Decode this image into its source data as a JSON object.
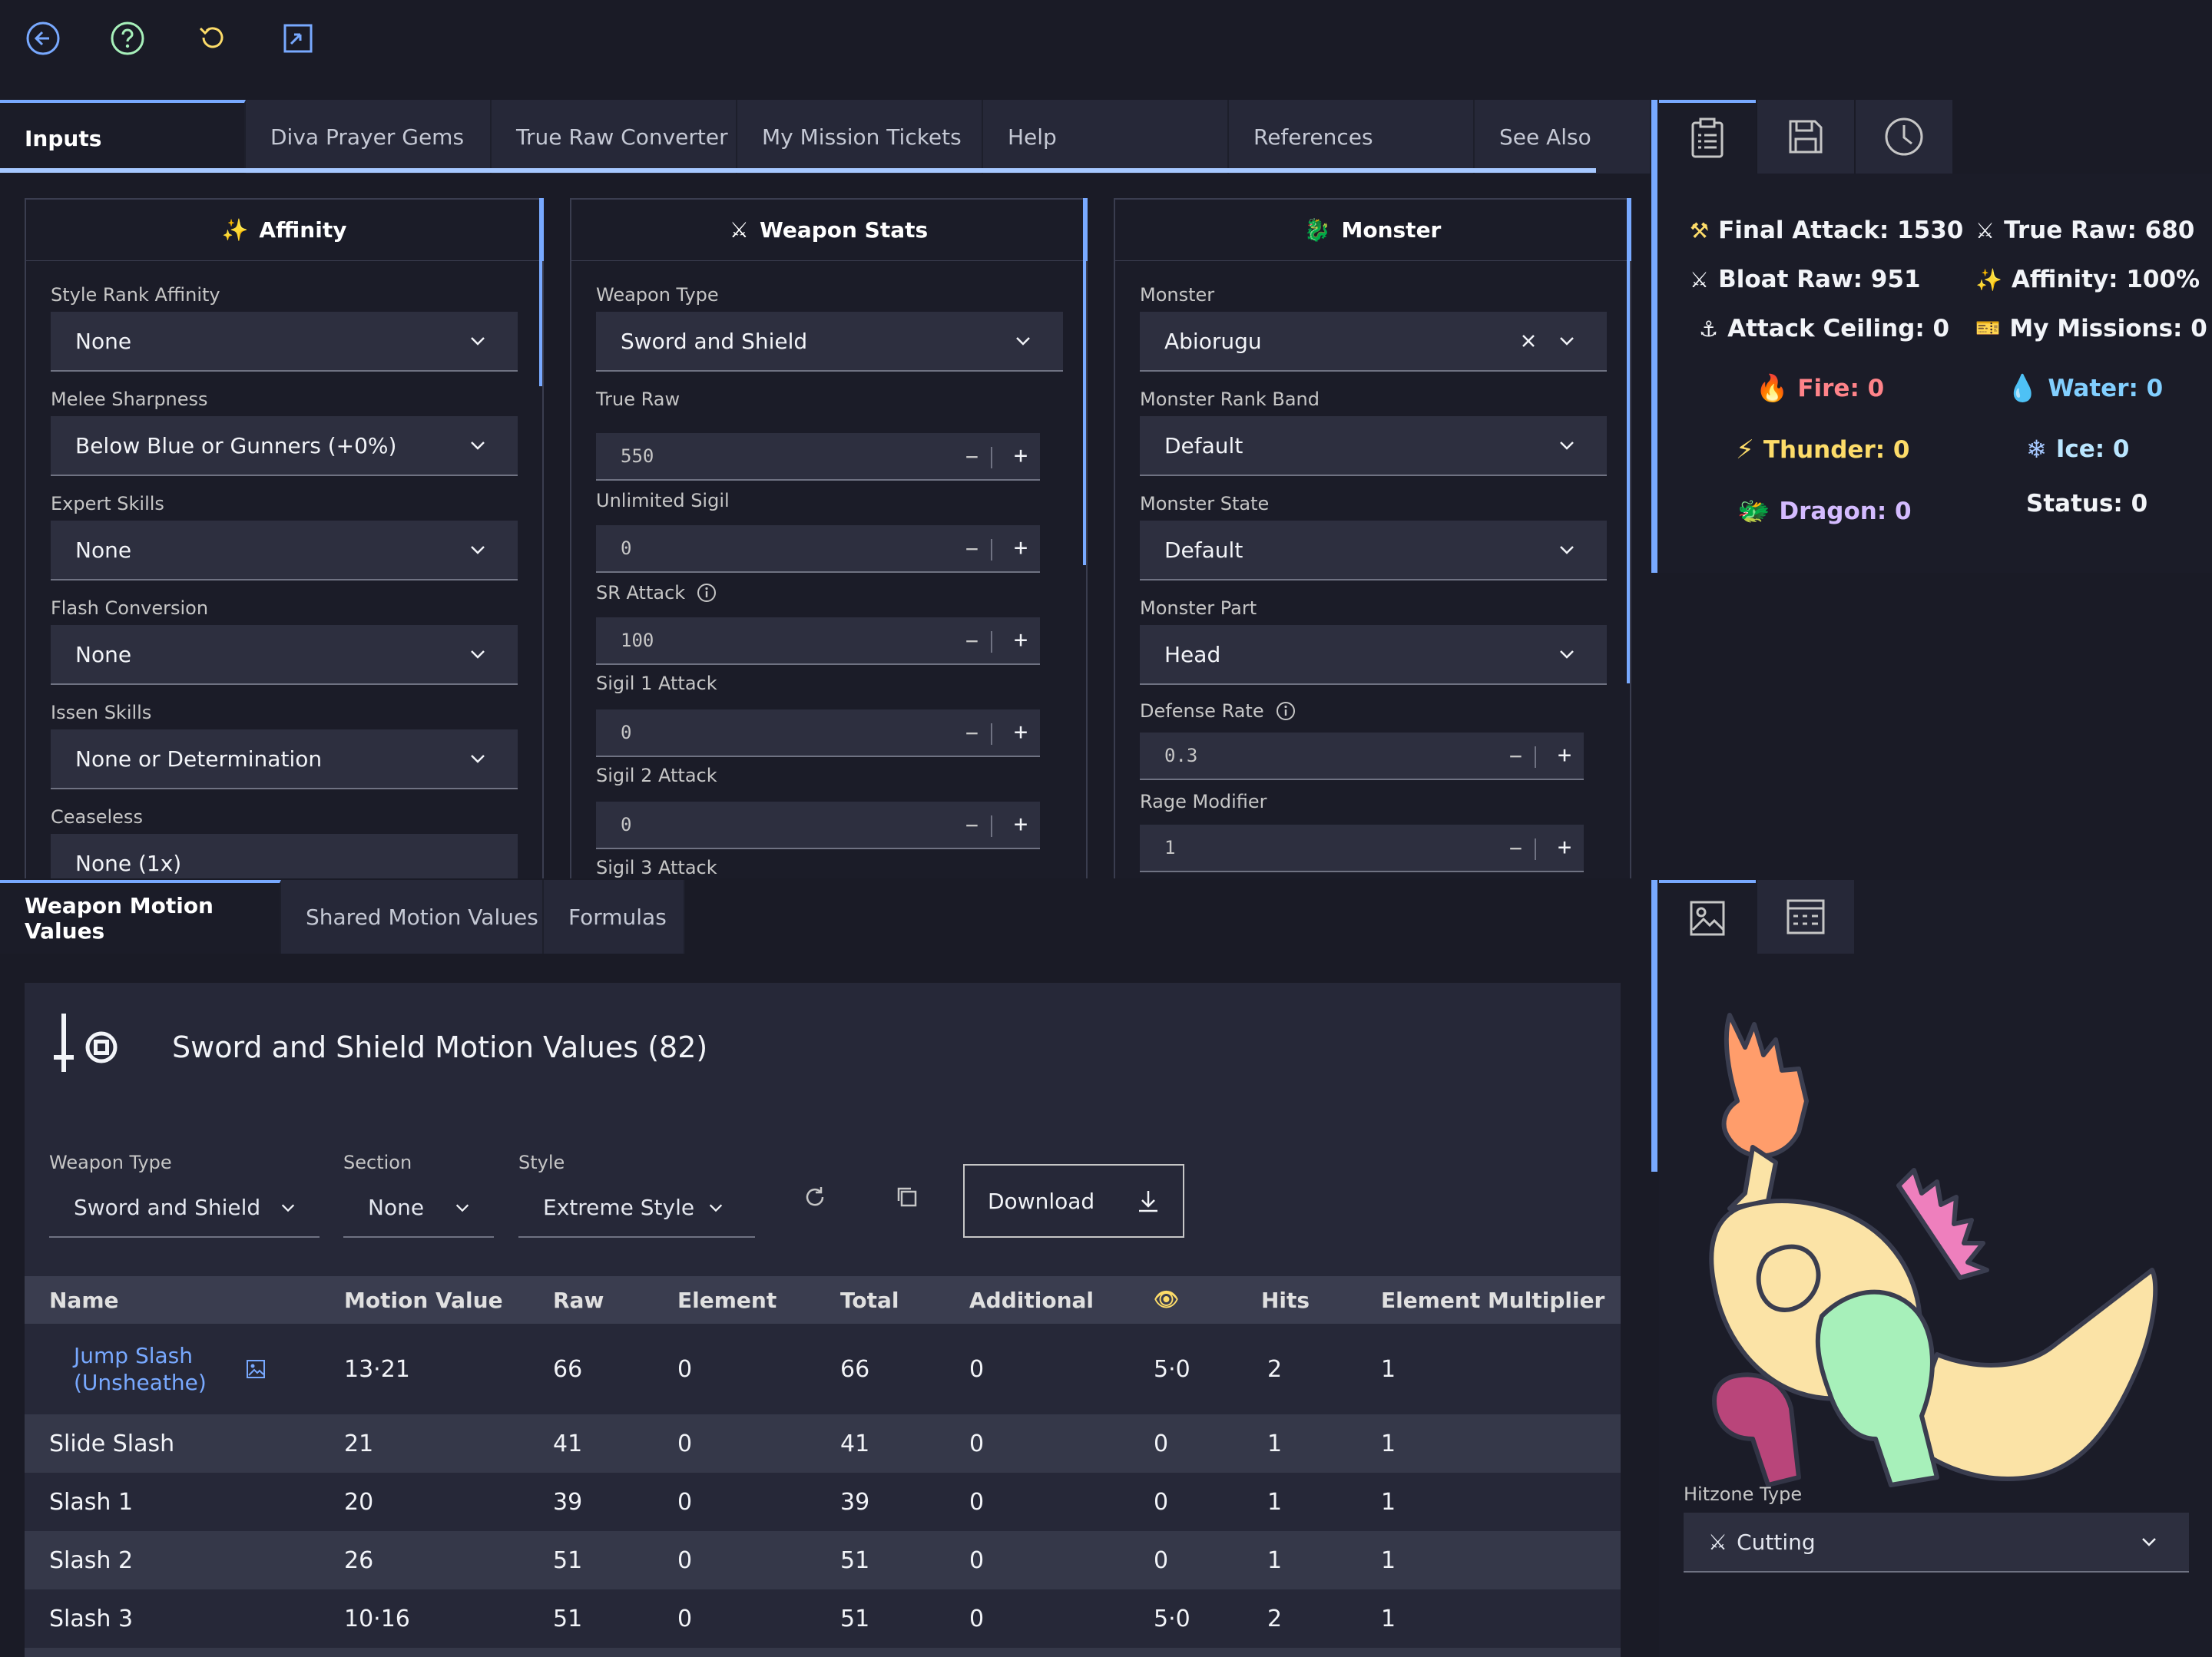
{
  "colors": {
    "accent": "#78a9ff",
    "link": "#78a9ff",
    "fire": "#ff8389",
    "water": "#82cfff",
    "thunder": "#fddc69",
    "ice": "#bae6ff",
    "dragon": "#d4bbff"
  },
  "toolbar": {
    "icons": [
      "back-arrow-icon",
      "help-icon",
      "reset-icon",
      "fullscreen-icon"
    ]
  },
  "tabs": [
    "Inputs",
    "Diva Prayer Gems",
    "True Raw Converter",
    "My Mission Tickets",
    "Help",
    "References",
    "See Also"
  ],
  "affinity": {
    "title": "Affinity",
    "fields": [
      {
        "label": "Style Rank Affinity",
        "value": "None"
      },
      {
        "label": "Melee Sharpness",
        "value": "Below Blue or Gunners (+0%)"
      },
      {
        "label": "Expert Skills",
        "value": "None"
      },
      {
        "label": "Flash Conversion",
        "value": "None"
      },
      {
        "label": "Issen Skills",
        "value": "None or Determination"
      },
      {
        "label": "Ceaseless",
        "value": "None (1x)"
      }
    ]
  },
  "weapon_stats": {
    "title": "Weapon Stats",
    "weapon_type_label": "Weapon Type",
    "weapon_type": "Sword and Shield",
    "inputs": [
      {
        "label": "True Raw",
        "value": "550"
      },
      {
        "label": "Unlimited Sigil",
        "value": "0"
      },
      {
        "label": "SR Attack",
        "value": "100"
      },
      {
        "label": "Sigil 1 Attack",
        "value": "0"
      },
      {
        "label": "Sigil 2 Attack",
        "value": "0"
      },
      {
        "label": "Sigil 3 Attack",
        "value": ""
      }
    ]
  },
  "monster": {
    "title": "Monster",
    "monster_label": "Monster",
    "monster": "Abiorugu",
    "rank_band_label": "Monster Rank Band",
    "rank_band": "Default",
    "state_label": "Monster State",
    "state": "Default",
    "part_label": "Monster Part",
    "part": "Head",
    "defense_label": "Defense Rate",
    "defense": "0.3",
    "rage_label": "Rage Modifier",
    "rage": "1"
  },
  "stats": {
    "final_attack": "Final Attack: 1530",
    "true_raw": "True Raw: 680",
    "bloat_raw": "Bloat Raw: 951",
    "affinity": "Affinity: 100%",
    "attack_ceiling": "Attack Ceiling: 0",
    "my_missions": "My Missions: 0",
    "fire": "Fire: 0",
    "water": "Water: 0",
    "thunder": "Thunder: 0",
    "ice": "Ice: 0",
    "dragon": "Dragon: 0",
    "status": "Status: 0"
  },
  "bottom_tabs": [
    "Weapon Motion Values",
    "Shared Motion Values",
    "Formulas"
  ],
  "motion": {
    "title": "Sword and Shield Motion Values (82)",
    "weapon_type_label": "Weapon Type",
    "weapon_type": "Sword and Shield",
    "section_label": "Section",
    "section": "None",
    "style_label": "Style",
    "style": "Extreme Style",
    "download": "Download",
    "headers": [
      "Name",
      "Motion Value",
      "Raw",
      "Element",
      "Total",
      "Additional",
      "",
      "Hits",
      "Element Multiplier"
    ],
    "rows": [
      {
        "name": "Jump Slash\n(Unsheathe)",
        "mv": "13·21",
        "raw": "66",
        "element": "0",
        "total": "66",
        "additional": "0",
        "stun": "5·0",
        "hits": "2",
        "mult": "1"
      },
      {
        "name": "Slide Slash",
        "mv": "21",
        "raw": "41",
        "element": "0",
        "total": "41",
        "additional": "0",
        "stun": "0",
        "hits": "1",
        "mult": "1"
      },
      {
        "name": "Slash 1",
        "mv": "20",
        "raw": "39",
        "element": "0",
        "total": "39",
        "additional": "0",
        "stun": "0",
        "hits": "1",
        "mult": "1"
      },
      {
        "name": "Slash 2",
        "mv": "26",
        "raw": "51",
        "element": "0",
        "total": "51",
        "additional": "0",
        "stun": "0",
        "hits": "1",
        "mult": "1"
      },
      {
        "name": "Slash 3",
        "mv": "10·16",
        "raw": "51",
        "element": "0",
        "total": "51",
        "additional": "0",
        "stun": "5·0",
        "hits": "2",
        "mult": "1"
      }
    ]
  },
  "hitzone": {
    "label": "Hitzone Type",
    "value": "Cutting"
  }
}
